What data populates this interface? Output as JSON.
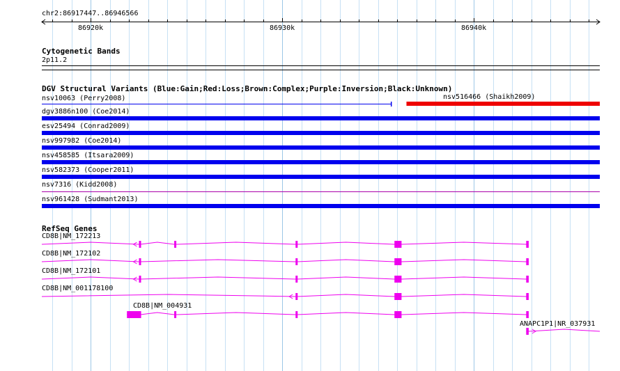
{
  "ruler": {
    "region": "chr2:86917447..86946566",
    "start": 86917447,
    "end": 86946566,
    "ticks": [
      {
        "pos": 86920000,
        "label": "86920k"
      },
      {
        "pos": 86930000,
        "label": "86930k"
      },
      {
        "pos": 86940000,
        "label": "86940k"
      }
    ]
  },
  "cyto": {
    "title": "Cytogenetic Bands",
    "band": "2p11.2"
  },
  "dgv": {
    "title": "DGV Structural Variants (Blue:Gain;Red:Loss;Brown:Complex;Purple:Inversion;Black:Unknown)",
    "legend_colors": {
      "gain": "#0000ee",
      "loss": "#ee0000",
      "inversion": "#aa00aa"
    },
    "variants": [
      {
        "id": "nsv10063 (Perry2008)",
        "start": 86917447,
        "end": 86935685,
        "type": "gain",
        "style": "thin"
      },
      {
        "id": "nsv516466 (Shaikh2009)",
        "start": 86936477,
        "end": 86946566,
        "type": "loss",
        "style": "thick"
      },
      {
        "id": "dgv3886n100 (Coe2014)",
        "start": 86917447,
        "end": 86946566,
        "type": "gain",
        "style": "thick"
      },
      {
        "id": "esv25494 (Conrad2009)",
        "start": 86917447,
        "end": 86946566,
        "type": "gain",
        "style": "thick"
      },
      {
        "id": "nsv997982 (Coe2014)",
        "start": 86917447,
        "end": 86946566,
        "type": "gain",
        "style": "thick"
      },
      {
        "id": "nsv458585 (Itsara2009)",
        "start": 86917447,
        "end": 86946566,
        "type": "gain",
        "style": "thick"
      },
      {
        "id": "nsv582373 (Cooper2011)",
        "start": 86917447,
        "end": 86946566,
        "type": "gain",
        "style": "thick"
      },
      {
        "id": "nsv7316 (Kidd2008)",
        "start": 86917447,
        "end": 86946566,
        "type": "inversion",
        "style": "thin"
      },
      {
        "id": "nsv961428 (Sudmant2013)",
        "start": 86917447,
        "end": 86946566,
        "type": "gain",
        "style": "thick"
      }
    ]
  },
  "refseq": {
    "title": "RefSeq Genes",
    "color": "#ee00ee",
    "genes": [
      {
        "name": "CD8B|NM_172213",
        "start": 86917447,
        "end": 86942855,
        "strand": "-",
        "utr": [
          86922518,
          86922590
        ],
        "exons": [
          [
            86922518,
            86922590
          ],
          [
            86924357,
            86924465
          ],
          [
            86930690,
            86930770
          ],
          [
            86935850,
            86936220
          ],
          [
            86942725,
            86942855
          ]
        ]
      },
      {
        "name": "CD8B|NM_172102",
        "start": 86917447,
        "end": 86942855,
        "strand": "-",
        "utr": [
          86922518,
          86922590
        ],
        "exons": [
          [
            86922518,
            86922590
          ],
          [
            86930690,
            86930770
          ],
          [
            86935850,
            86936220
          ],
          [
            86942725,
            86942855
          ]
        ]
      },
      {
        "name": "CD8B|NM_172101",
        "start": 86917447,
        "end": 86942855,
        "strand": "-",
        "utr": [
          86922518,
          86922590
        ],
        "exons": [
          [
            86922518,
            86922590
          ],
          [
            86930690,
            86930770
          ],
          [
            86935850,
            86936220
          ],
          [
            86942725,
            86942855
          ]
        ]
      },
      {
        "name": "CD8B|NM_001178100",
        "start": 86917447,
        "end": 86942855,
        "strand": "-",
        "utr": [
          86930650,
          86930680
        ],
        "exons": [
          [
            86930690,
            86930770
          ],
          [
            86935850,
            86936220
          ],
          [
            86942725,
            86942855
          ]
        ]
      },
      {
        "name": "CD8B|NM_004931",
        "start": 86921890,
        "end": 86942855,
        "strand": "-",
        "utr": null,
        "exons": [
          [
            86921890,
            86922630
          ],
          [
            86922518,
            86922590
          ],
          [
            86924357,
            86924465
          ],
          [
            86930690,
            86930770
          ],
          [
            86935850,
            86936220
          ],
          [
            86942725,
            86942855
          ]
        ]
      },
      {
        "name": "ANAPC1P1|NR_037931",
        "start": 86942725,
        "end": 86946566,
        "strand": "+",
        "utr": null,
        "exons": [
          [
            86942725,
            86942855
          ]
        ]
      }
    ]
  }
}
